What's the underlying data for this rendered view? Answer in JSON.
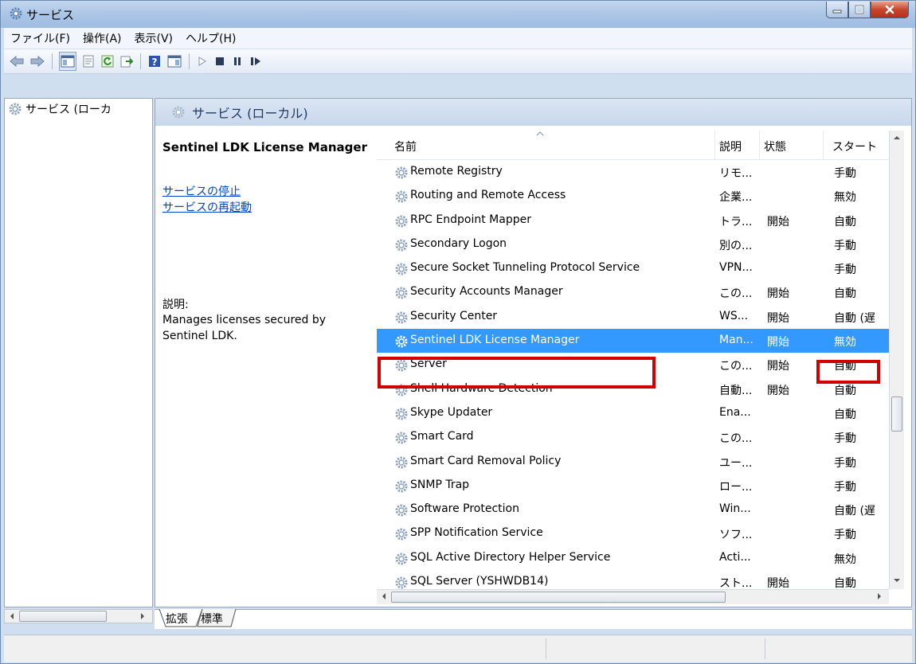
{
  "window": {
    "title": "サービス"
  },
  "menu": [
    "ファイル(F)",
    "操作(A)",
    "表示(V)",
    "ヘルプ(H)"
  ],
  "tree": {
    "root": "サービス (ローカ"
  },
  "panel": {
    "header": "サービス (ローカル)"
  },
  "details": {
    "service_name": "Sentinel LDK License Manager",
    "stop_link": "サービスの停止",
    "restart_link": "サービスの再起動",
    "description_label": "説明:",
    "description_text": "Manages licenses secured by Sentinel LDK."
  },
  "columns": {
    "name": "名前",
    "description": "説明",
    "status": "状態",
    "startup": "スタート"
  },
  "services": [
    {
      "name": "Remote Registry",
      "description": "リモ...",
      "status": "",
      "startup": "手動"
    },
    {
      "name": "Routing and Remote Access",
      "description": "企業...",
      "status": "",
      "startup": "無効"
    },
    {
      "name": "RPC Endpoint Mapper",
      "description": "トラ...",
      "status": "開始",
      "startup": "自動"
    },
    {
      "name": "Secondary Logon",
      "description": "別の...",
      "status": "",
      "startup": "手動"
    },
    {
      "name": "Secure Socket Tunneling Protocol Service",
      "description": "VPN...",
      "status": "",
      "startup": "手動"
    },
    {
      "name": "Security Accounts Manager",
      "description": "この...",
      "status": "開始",
      "startup": "自動"
    },
    {
      "name": "Security Center",
      "description": "WS...",
      "status": "開始",
      "startup": "自動 (遅"
    },
    {
      "name": "Sentinel LDK License Manager",
      "description": "Man...",
      "status": "開始",
      "startup": "無効",
      "selected": true
    },
    {
      "name": "Server",
      "description": "この...",
      "status": "開始",
      "startup": "自動"
    },
    {
      "name": "Shell Hardware Detection",
      "description": "自動...",
      "status": "開始",
      "startup": "自動"
    },
    {
      "name": "Skype Updater",
      "description": "Ena...",
      "status": "",
      "startup": "自動"
    },
    {
      "name": "Smart Card",
      "description": "この...",
      "status": "",
      "startup": "手動"
    },
    {
      "name": "Smart Card Removal Policy",
      "description": "ユー...",
      "status": "",
      "startup": "手動"
    },
    {
      "name": "SNMP Trap",
      "description": "ロー...",
      "status": "",
      "startup": "手動"
    },
    {
      "name": "Software Protection",
      "description": "Win...",
      "status": "",
      "startup": "自動 (遅"
    },
    {
      "name": "SPP Notification Service",
      "description": "ソフ...",
      "status": "",
      "startup": "手動"
    },
    {
      "name": "SQL Active Directory Helper Service",
      "description": "Acti...",
      "status": "",
      "startup": "無効"
    },
    {
      "name": "SQL Server (YSHWDB14)",
      "description": "スト...",
      "status": "開始",
      "startup": "自動"
    }
  ],
  "tabs": [
    "拡張",
    "標準"
  ],
  "colors": {
    "selection": "#3399ff",
    "highlight_box": "#d40000",
    "link": "#0044cc"
  }
}
